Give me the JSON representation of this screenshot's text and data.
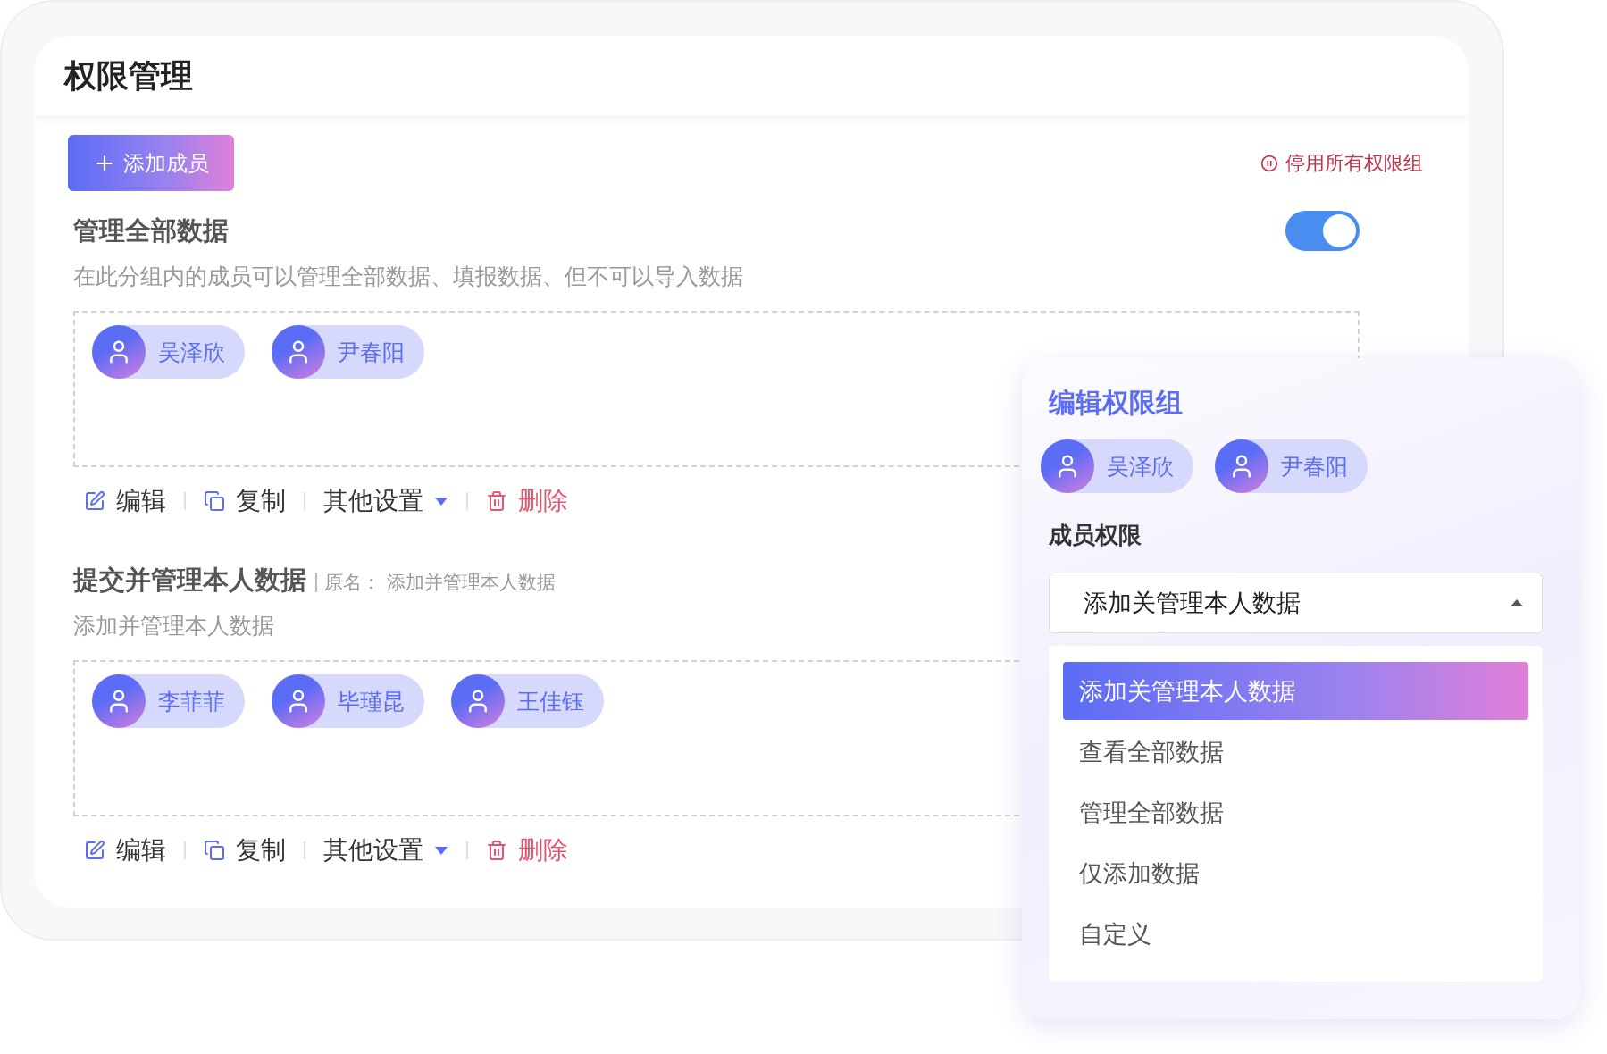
{
  "page": {
    "title": "权限管理"
  },
  "toolbar": {
    "add_button": "添加成员",
    "disable_all": "停用所有权限组"
  },
  "groups": [
    {
      "title": "管理全部数据",
      "enabled": true,
      "description": "在此分组内的成员可以管理全部数据、填报数据、但不可以导入数据",
      "members": [
        "吴泽欣",
        "尹春阳"
      ],
      "actions": [
        {
          "kind": "edit",
          "label": "编辑"
        },
        {
          "kind": "copy",
          "label": "复制"
        },
        {
          "kind": "menu",
          "label": "其他设置"
        },
        {
          "kind": "delete",
          "label": "删除"
        }
      ]
    },
    {
      "title": "提交并管理本人数据",
      "original_name": "原名： 添加并管理本人数据",
      "description": "添加并管理本人数据",
      "members": [
        "李菲菲",
        "毕瑾昆",
        "王佳钰"
      ],
      "actions": [
        {
          "kind": "edit",
          "label": "编辑"
        },
        {
          "kind": "copy",
          "label": "复制"
        },
        {
          "kind": "menu",
          "label": "其他设置"
        },
        {
          "kind": "delete",
          "label": "删除"
        }
      ]
    }
  ],
  "popup": {
    "title": "编辑权限组",
    "members": [
      "吴泽欣",
      "尹春阳"
    ],
    "section_label": "成员权限",
    "select": {
      "value": "添加关管理本人数据",
      "expanded": true
    },
    "options": [
      {
        "label": "添加关管理本人数据",
        "selected": true
      },
      {
        "label": "查看全部数据",
        "selected": false
      },
      {
        "label": "管理全部数据",
        "selected": false
      },
      {
        "label": "仅添加数据",
        "selected": false
      },
      {
        "label": "自定义",
        "selected": false
      }
    ]
  }
}
